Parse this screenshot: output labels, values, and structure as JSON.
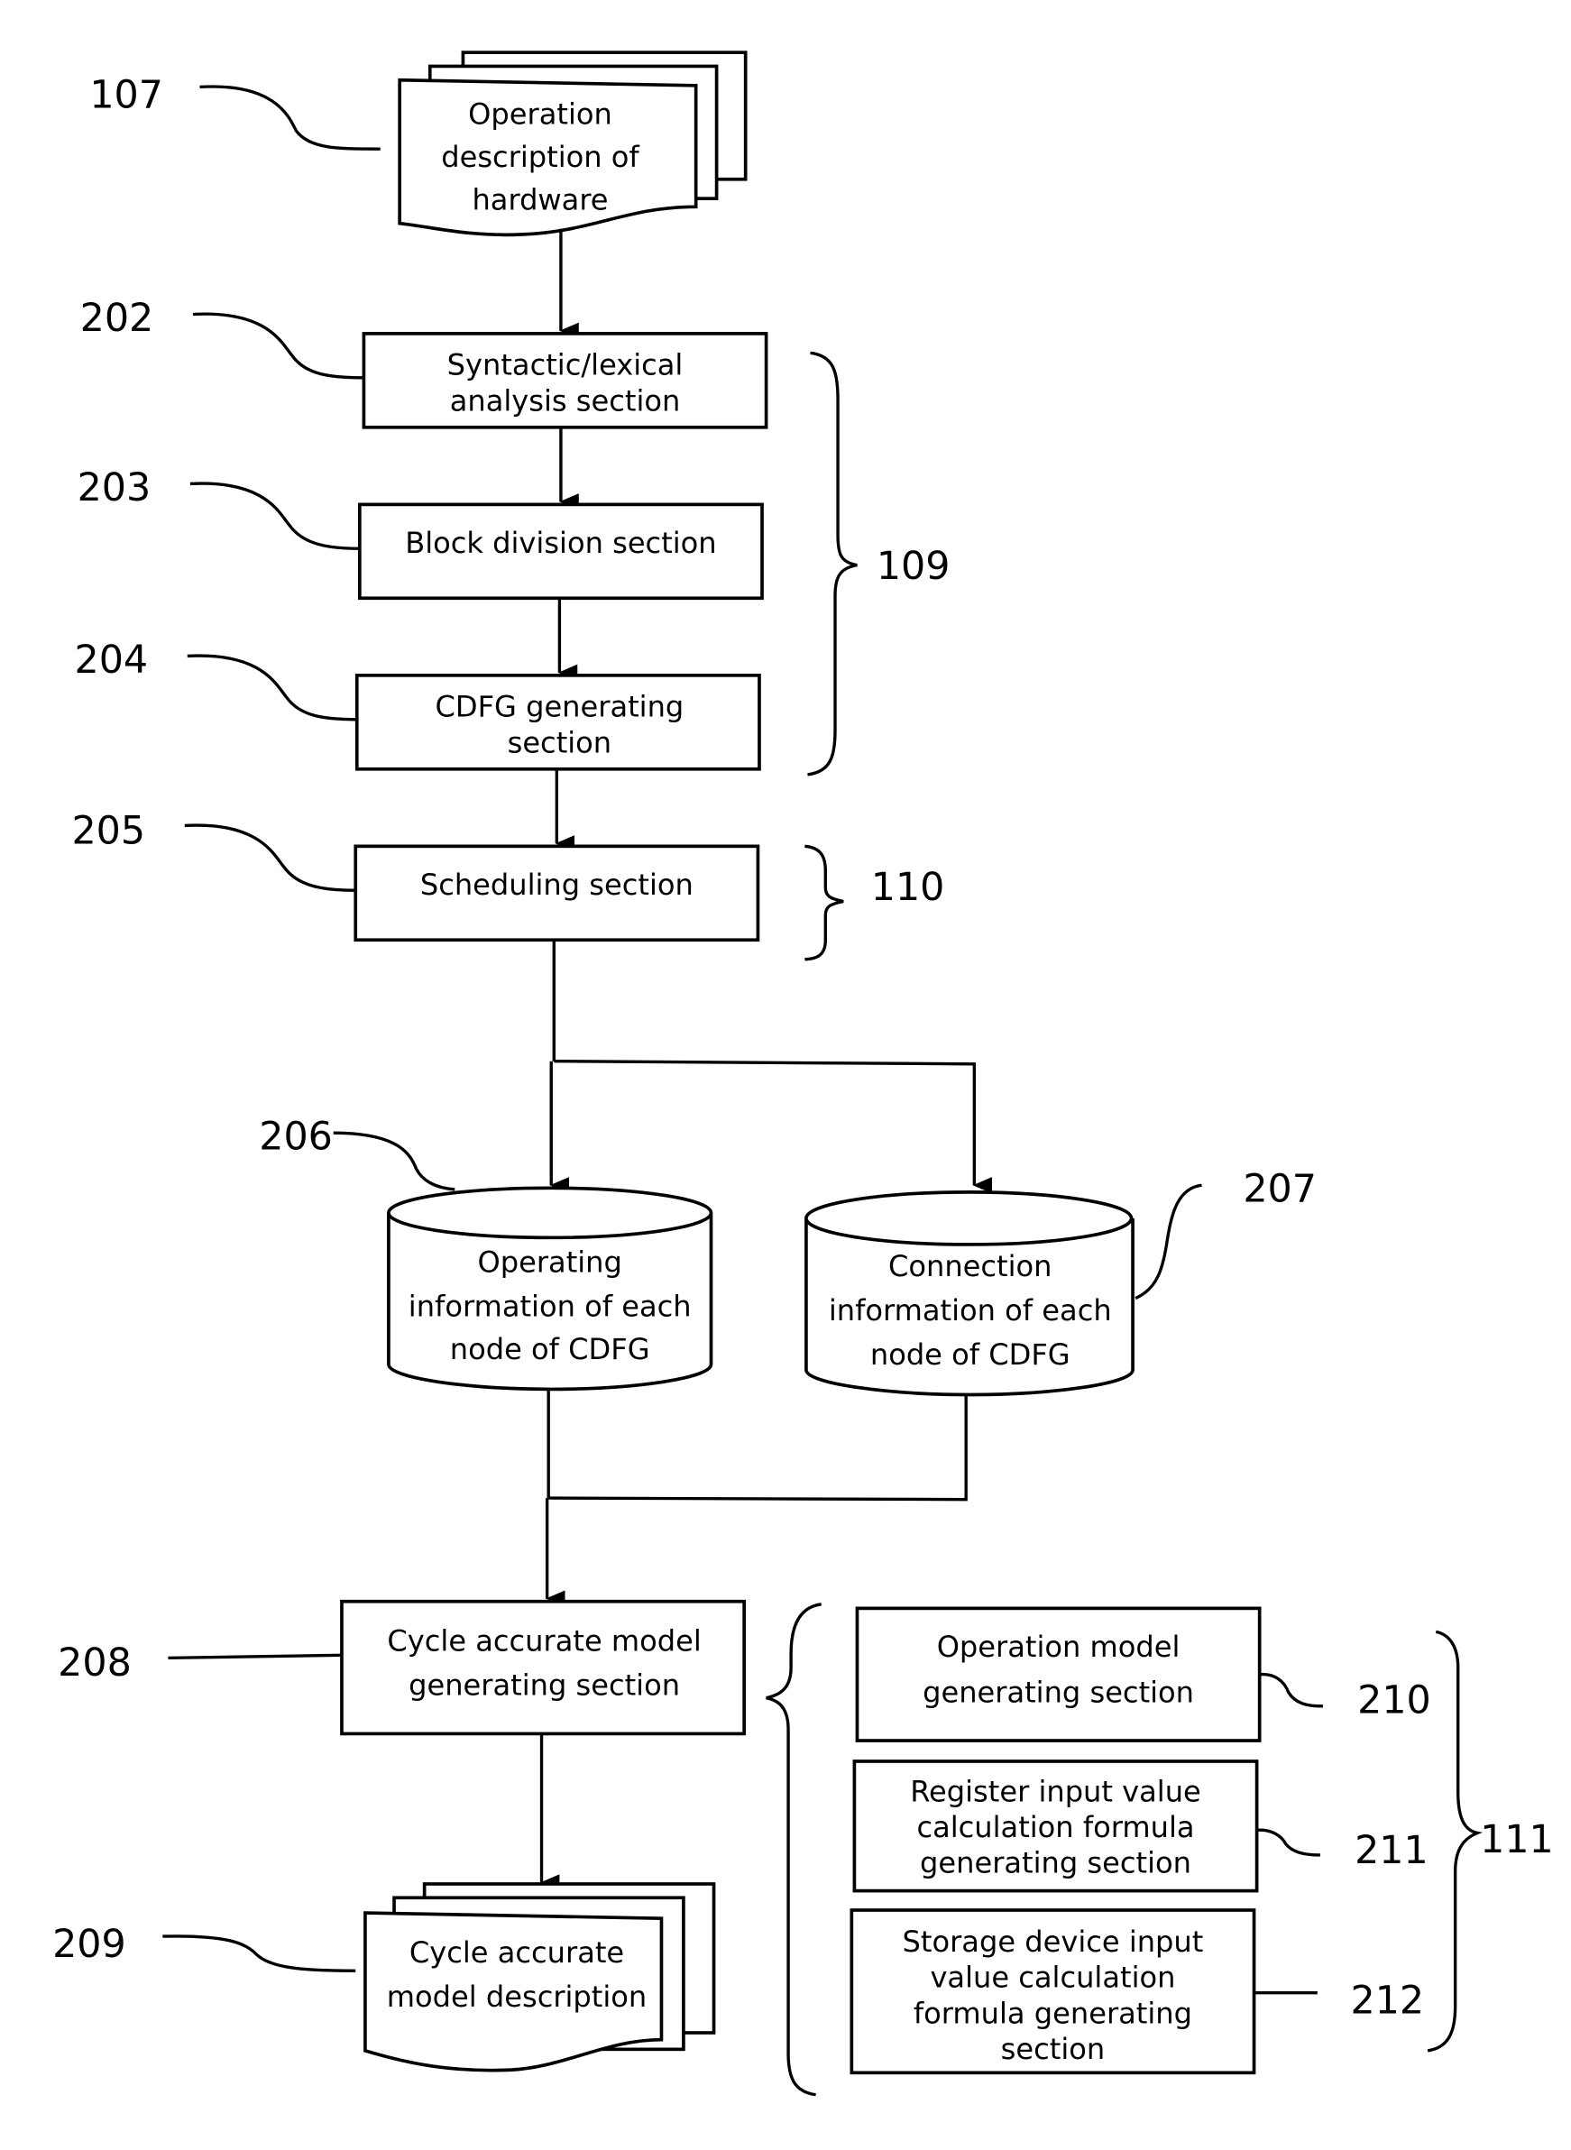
{
  "diagram": {
    "nodes": {
      "n107": {
        "ref": "107",
        "lines": [
          "Operation",
          "description of",
          "hardware"
        ]
      },
      "n202": {
        "ref": "202",
        "lines": [
          "Syntactic/lexical",
          "analysis section"
        ]
      },
      "n203": {
        "ref": "203",
        "lines": [
          "Block division section"
        ]
      },
      "n204": {
        "ref": "204",
        "lines": [
          "CDFG generating",
          "section"
        ]
      },
      "n205": {
        "ref": "205",
        "lines": [
          "Scheduling section"
        ]
      },
      "n206": {
        "ref": "206",
        "lines": [
          "Operating",
          "information of each",
          "node of CDFG"
        ]
      },
      "n207": {
        "ref": "207",
        "lines": [
          "Connection",
          "information of each",
          "node of CDFG"
        ]
      },
      "n208": {
        "ref": "208",
        "lines": [
          "Cycle accurate model",
          "generating section"
        ]
      },
      "n209": {
        "ref": "209",
        "lines": [
          "Cycle accurate",
          "model description"
        ]
      },
      "n210": {
        "ref": "210",
        "lines": [
          "Operation model",
          "generating section"
        ]
      },
      "n211": {
        "ref": "211",
        "lines": [
          "Register input value",
          "calculation formula",
          "generating section"
        ]
      },
      "n212": {
        "ref": "212",
        "lines": [
          "Storage device input",
          "value calculation",
          "formula generating",
          "section"
        ]
      }
    },
    "groups": {
      "g109": {
        "ref": "109"
      },
      "g110": {
        "ref": "110"
      },
      "g111": {
        "ref": "111"
      }
    }
  }
}
